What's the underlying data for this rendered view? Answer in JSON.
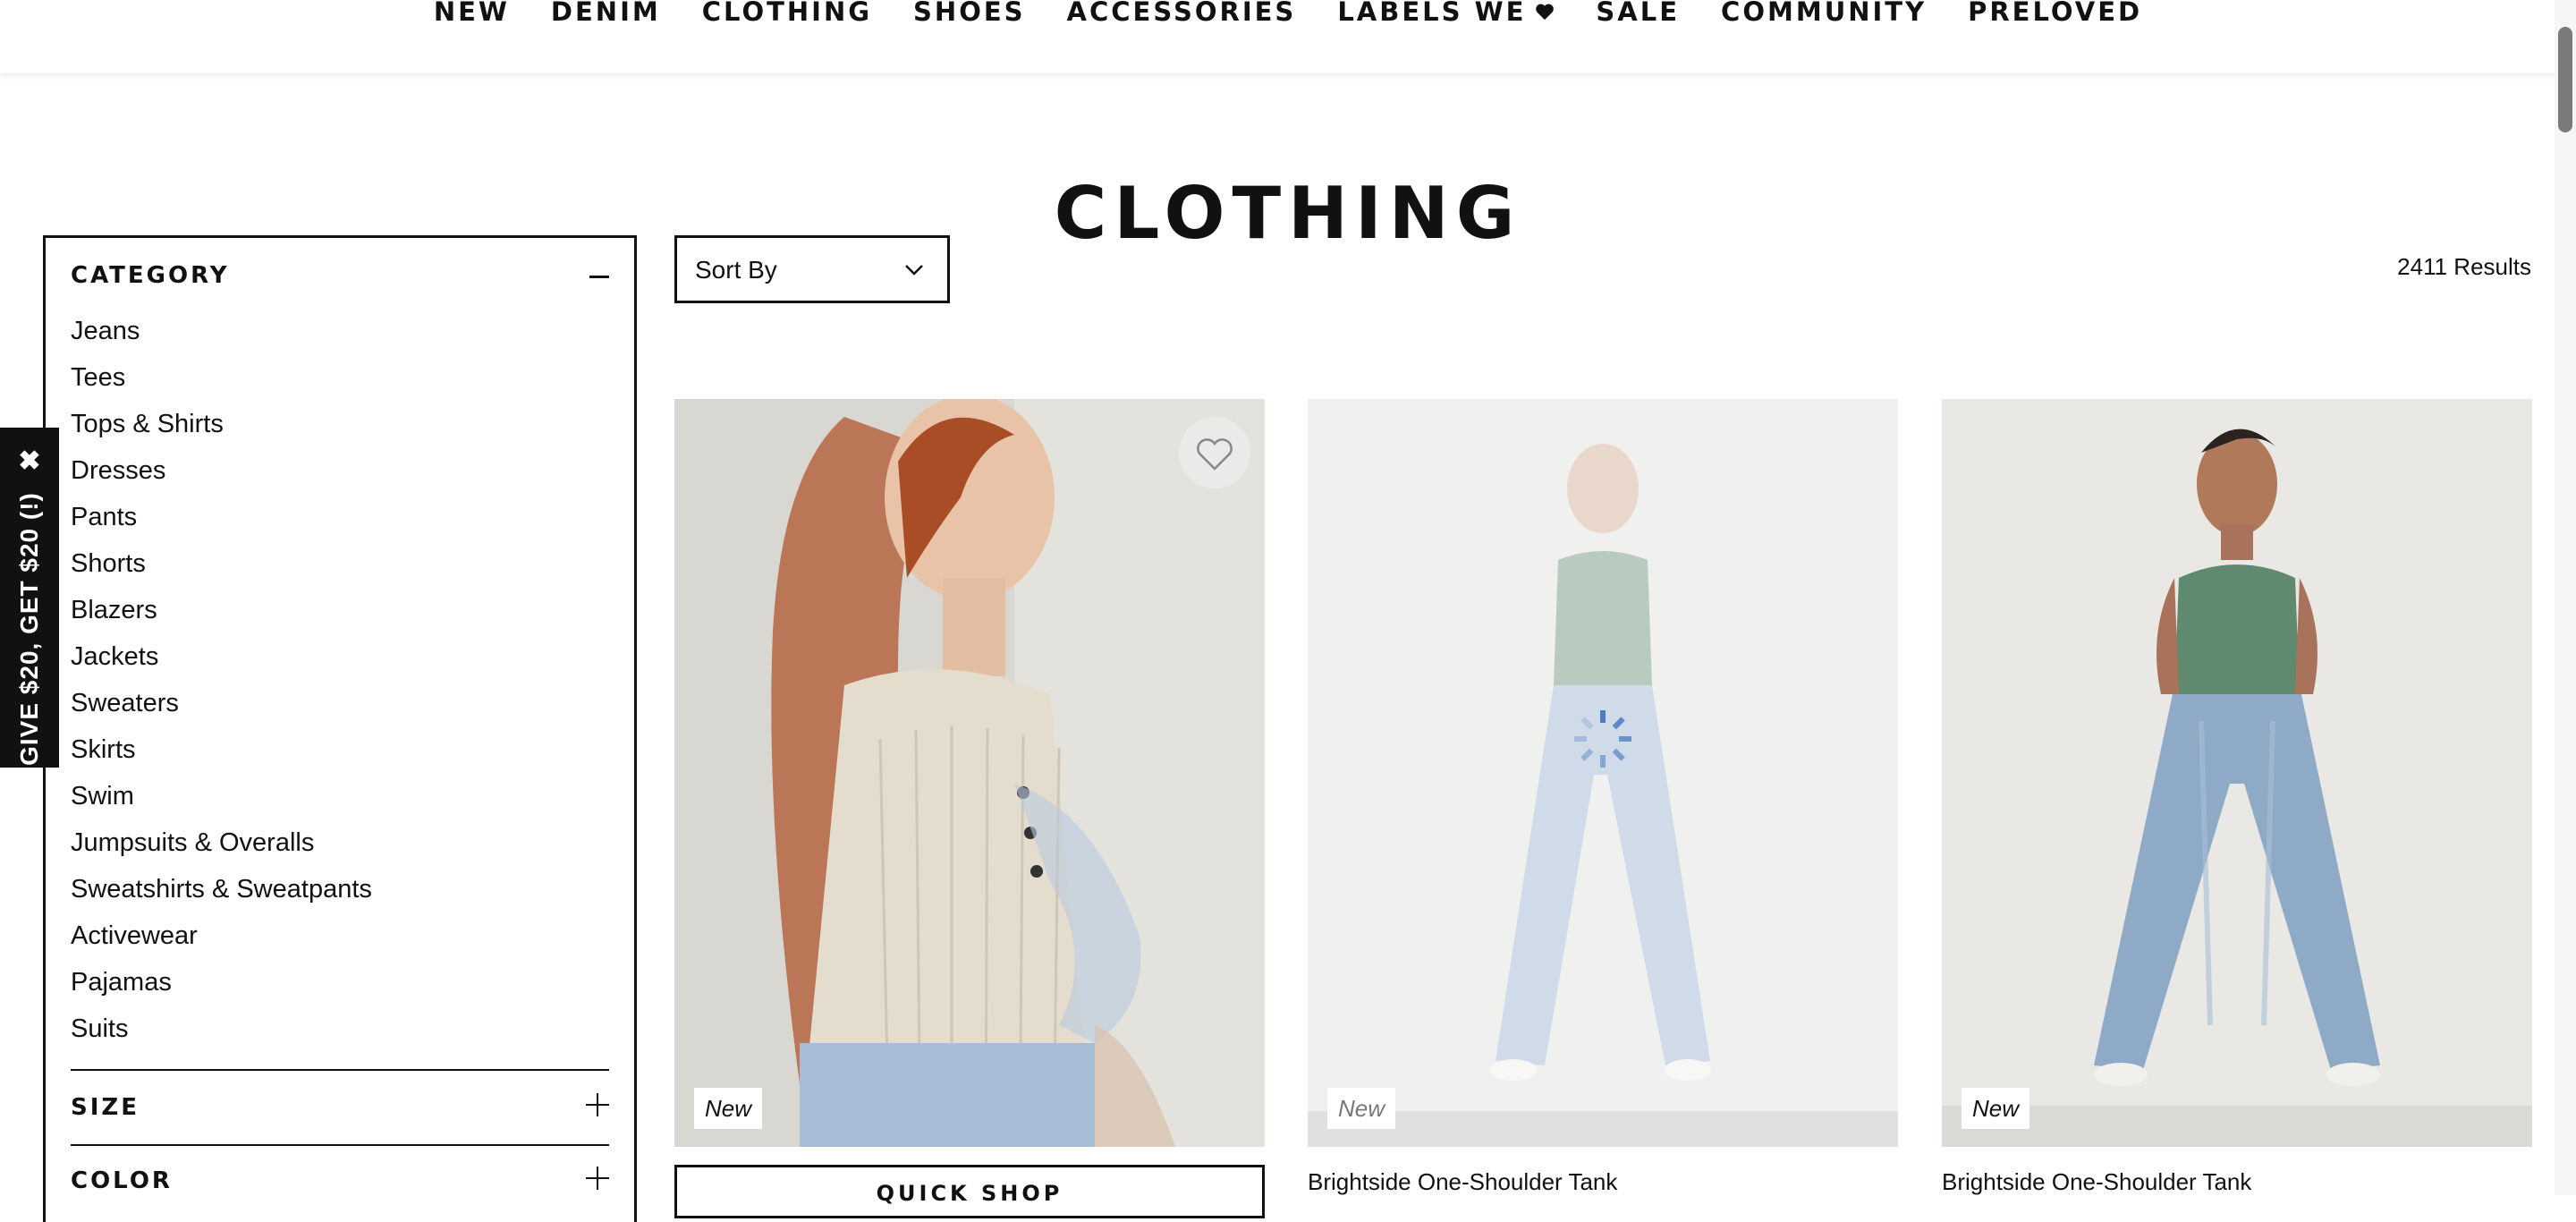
{
  "nav": {
    "items": [
      "NEW",
      "DENIM",
      "CLOTHING",
      "SHOES",
      "ACCESSORIES",
      "LABELS WE",
      "SALE",
      "COMMUNITY",
      "PRELOVED"
    ],
    "labels_icon": "heart-icon"
  },
  "page": {
    "title": "CLOTHING"
  },
  "filters": {
    "category": {
      "title": "CATEGORY",
      "items": [
        "Jeans",
        "Tees",
        "Tops & Shirts",
        "Dresses",
        "Pants",
        "Shorts",
        "Blazers",
        "Jackets",
        "Sweaters",
        "Skirts",
        "Swim",
        "Jumpsuits & Overalls",
        "Sweatshirts & Sweatpants",
        "Activewear",
        "Pajamas",
        "Suits"
      ]
    },
    "size": {
      "title": "SIZE"
    },
    "color": {
      "title": "COLOR"
    }
  },
  "promo": {
    "text": "GIVE $20, GET $20 (!)",
    "close": "✖"
  },
  "toolbar": {
    "sort_label": "Sort By",
    "results": "2411 Results"
  },
  "products": [
    {
      "badge": "New",
      "name": "",
      "quick_shop": "QUICK SHOP"
    },
    {
      "badge": "New",
      "name": "Brightside One-Shoulder Tank"
    },
    {
      "badge": "New",
      "name": "Brightside One-Shoulder Tank"
    }
  ],
  "colors": {
    "text": "#111111",
    "background": "#ffffff",
    "top_green": "#5f8a70",
    "denim": "#9cb4cf",
    "cream_knit": "#e4dccd",
    "hair": "#b0562e"
  }
}
